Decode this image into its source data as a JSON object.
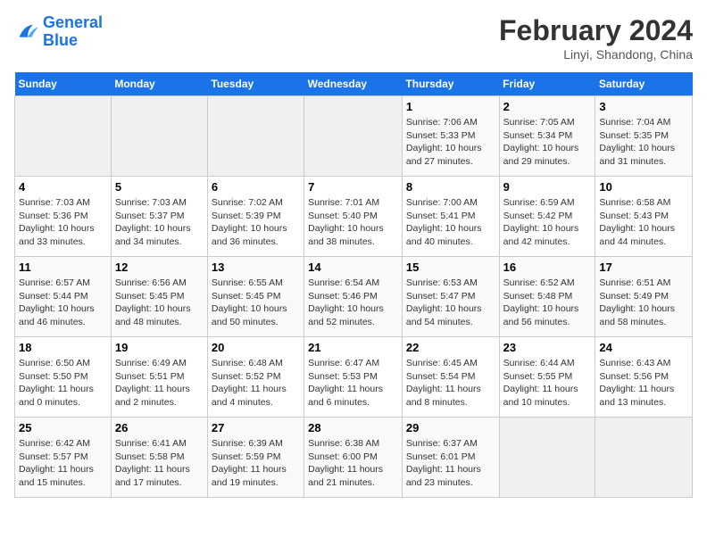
{
  "header": {
    "logo_line1": "General",
    "logo_line2": "Blue",
    "month": "February 2024",
    "location": "Linyi, Shandong, China"
  },
  "days_of_week": [
    "Sunday",
    "Monday",
    "Tuesday",
    "Wednesday",
    "Thursday",
    "Friday",
    "Saturday"
  ],
  "weeks": [
    [
      {
        "day": "",
        "empty": true
      },
      {
        "day": "",
        "empty": true
      },
      {
        "day": "",
        "empty": true
      },
      {
        "day": "",
        "empty": true
      },
      {
        "day": "1",
        "sunrise": "7:06 AM",
        "sunset": "5:33 PM",
        "daylight": "10 hours and 27 minutes."
      },
      {
        "day": "2",
        "sunrise": "7:05 AM",
        "sunset": "5:34 PM",
        "daylight": "10 hours and 29 minutes."
      },
      {
        "day": "3",
        "sunrise": "7:04 AM",
        "sunset": "5:35 PM",
        "daylight": "10 hours and 31 minutes."
      }
    ],
    [
      {
        "day": "4",
        "sunrise": "7:03 AM",
        "sunset": "5:36 PM",
        "daylight": "10 hours and 33 minutes."
      },
      {
        "day": "5",
        "sunrise": "7:03 AM",
        "sunset": "5:37 PM",
        "daylight": "10 hours and 34 minutes."
      },
      {
        "day": "6",
        "sunrise": "7:02 AM",
        "sunset": "5:39 PM",
        "daylight": "10 hours and 36 minutes."
      },
      {
        "day": "7",
        "sunrise": "7:01 AM",
        "sunset": "5:40 PM",
        "daylight": "10 hours and 38 minutes."
      },
      {
        "day": "8",
        "sunrise": "7:00 AM",
        "sunset": "5:41 PM",
        "daylight": "10 hours and 40 minutes."
      },
      {
        "day": "9",
        "sunrise": "6:59 AM",
        "sunset": "5:42 PM",
        "daylight": "10 hours and 42 minutes."
      },
      {
        "day": "10",
        "sunrise": "6:58 AM",
        "sunset": "5:43 PM",
        "daylight": "10 hours and 44 minutes."
      }
    ],
    [
      {
        "day": "11",
        "sunrise": "6:57 AM",
        "sunset": "5:44 PM",
        "daylight": "10 hours and 46 minutes."
      },
      {
        "day": "12",
        "sunrise": "6:56 AM",
        "sunset": "5:45 PM",
        "daylight": "10 hours and 48 minutes."
      },
      {
        "day": "13",
        "sunrise": "6:55 AM",
        "sunset": "5:45 PM",
        "daylight": "10 hours and 50 minutes."
      },
      {
        "day": "14",
        "sunrise": "6:54 AM",
        "sunset": "5:46 PM",
        "daylight": "10 hours and 52 minutes."
      },
      {
        "day": "15",
        "sunrise": "6:53 AM",
        "sunset": "5:47 PM",
        "daylight": "10 hours and 54 minutes."
      },
      {
        "day": "16",
        "sunrise": "6:52 AM",
        "sunset": "5:48 PM",
        "daylight": "10 hours and 56 minutes."
      },
      {
        "day": "17",
        "sunrise": "6:51 AM",
        "sunset": "5:49 PM",
        "daylight": "10 hours and 58 minutes."
      }
    ],
    [
      {
        "day": "18",
        "sunrise": "6:50 AM",
        "sunset": "5:50 PM",
        "daylight": "11 hours and 0 minutes."
      },
      {
        "day": "19",
        "sunrise": "6:49 AM",
        "sunset": "5:51 PM",
        "daylight": "11 hours and 2 minutes."
      },
      {
        "day": "20",
        "sunrise": "6:48 AM",
        "sunset": "5:52 PM",
        "daylight": "11 hours and 4 minutes."
      },
      {
        "day": "21",
        "sunrise": "6:47 AM",
        "sunset": "5:53 PM",
        "daylight": "11 hours and 6 minutes."
      },
      {
        "day": "22",
        "sunrise": "6:45 AM",
        "sunset": "5:54 PM",
        "daylight": "11 hours and 8 minutes."
      },
      {
        "day": "23",
        "sunrise": "6:44 AM",
        "sunset": "5:55 PM",
        "daylight": "11 hours and 10 minutes."
      },
      {
        "day": "24",
        "sunrise": "6:43 AM",
        "sunset": "5:56 PM",
        "daylight": "11 hours and 13 minutes."
      }
    ],
    [
      {
        "day": "25",
        "sunrise": "6:42 AM",
        "sunset": "5:57 PM",
        "daylight": "11 hours and 15 minutes."
      },
      {
        "day": "26",
        "sunrise": "6:41 AM",
        "sunset": "5:58 PM",
        "daylight": "11 hours and 17 minutes."
      },
      {
        "day": "27",
        "sunrise": "6:39 AM",
        "sunset": "5:59 PM",
        "daylight": "11 hours and 19 minutes."
      },
      {
        "day": "28",
        "sunrise": "6:38 AM",
        "sunset": "6:00 PM",
        "daylight": "11 hours and 21 minutes."
      },
      {
        "day": "29",
        "sunrise": "6:37 AM",
        "sunset": "6:01 PM",
        "daylight": "11 hours and 23 minutes."
      },
      {
        "day": "",
        "empty": true
      },
      {
        "day": "",
        "empty": true
      }
    ]
  ]
}
